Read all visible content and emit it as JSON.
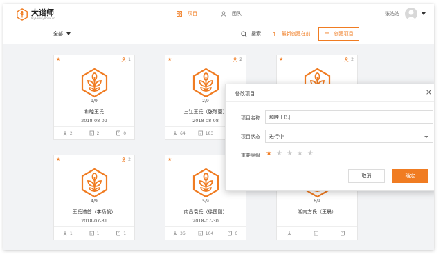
{
  "colors": {
    "accent": "#f07c22",
    "star_inactive": "#c8c8c8",
    "page_bg": "#f2f3f5"
  },
  "app": {
    "logo_title": "大谱师",
    "logo_subtitle": "MyFamilyBook.cn"
  },
  "nav": {
    "projects": "项目",
    "team": "团队"
  },
  "user": {
    "name": "张浩浩"
  },
  "toolbar": {
    "filter": "全部",
    "search": "搜索",
    "sort": "最新创建在前",
    "create": "创建项目"
  },
  "cards": [
    {
      "starred": true,
      "members": "1",
      "progress": "1/9",
      "name": "和睦王氏",
      "date": "2018-08-09",
      "stats": [
        "2",
        "2",
        "0"
      ]
    },
    {
      "starred": true,
      "members": "2",
      "progress": "2/9",
      "name": "三江王氏（张琼蕾）",
      "date": "2018-08-08",
      "stats": [
        "64",
        "183",
        ""
      ]
    },
    {
      "starred": true,
      "members": "2",
      "progress": "",
      "name": "",
      "date": "",
      "stats": [
        "",
        "",
        ""
      ]
    },
    {
      "starred": true,
      "members": "2",
      "progress": "4/9",
      "name": "王氏谱首（李扬帆）",
      "date": "2018-07-31",
      "stats": [
        "1",
        "1",
        "1"
      ]
    },
    {
      "starred": true,
      "members": "1",
      "progress": "5/9",
      "name": "南昌袁氏（徐国刚）",
      "date": "2018-07-30",
      "stats": [
        "36",
        "104",
        "6"
      ]
    },
    {
      "starred": false,
      "members": "",
      "progress": "6/9",
      "name": "湖南方氏（王晨）",
      "date": "",
      "stats": [
        "",
        "",
        ""
      ]
    }
  ],
  "modal": {
    "title": "修改项目",
    "close": "×",
    "name_label": "项目名称",
    "name_value": "和睦王氏|",
    "status_label": "项目状态",
    "status_value": "进行中",
    "rating_label": "重要等级",
    "rating": 1,
    "rating_max": 5,
    "cancel": "取消",
    "confirm": "确定"
  }
}
